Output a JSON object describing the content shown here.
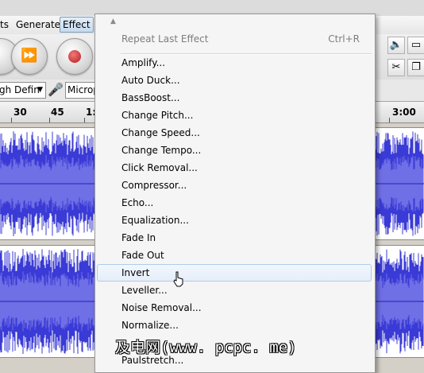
{
  "menubar": {
    "items": [
      {
        "label": "ts"
      },
      {
        "label": "Generate"
      },
      {
        "label": "Effect"
      }
    ]
  },
  "devices": {
    "host_value": "gh Defin",
    "mic_value": "Microph"
  },
  "ruler": {
    "ticks": [
      "30",
      "45",
      "1:",
      "3:00"
    ]
  },
  "effect_menu": {
    "repeat_last": {
      "label": "Repeat Last Effect",
      "shortcut": "Ctrl+R"
    },
    "items": [
      {
        "label": "Amplify..."
      },
      {
        "label": "Auto Duck..."
      },
      {
        "label": "BassBoost..."
      },
      {
        "label": "Change Pitch..."
      },
      {
        "label": "Change Speed..."
      },
      {
        "label": "Change Tempo..."
      },
      {
        "label": "Click Removal..."
      },
      {
        "label": "Compressor..."
      },
      {
        "label": "Echo..."
      },
      {
        "label": "Equalization..."
      },
      {
        "label": "Fade In"
      },
      {
        "label": "Fade Out"
      },
      {
        "label": "Invert"
      },
      {
        "label": "Leveller..."
      },
      {
        "label": "Noise Removal..."
      },
      {
        "label": "Normalize..."
      },
      {
        "label": "Paulstretch..."
      }
    ],
    "hovered_item": "Invert"
  },
  "watermark": {
    "text": "及电网(www. pcpc. me)"
  },
  "colors": {
    "waveform": "#3a3ad6",
    "waveform_dark": "#2323b0",
    "menu_hover_border": "#aecbeb",
    "record": "#b51b1b"
  }
}
